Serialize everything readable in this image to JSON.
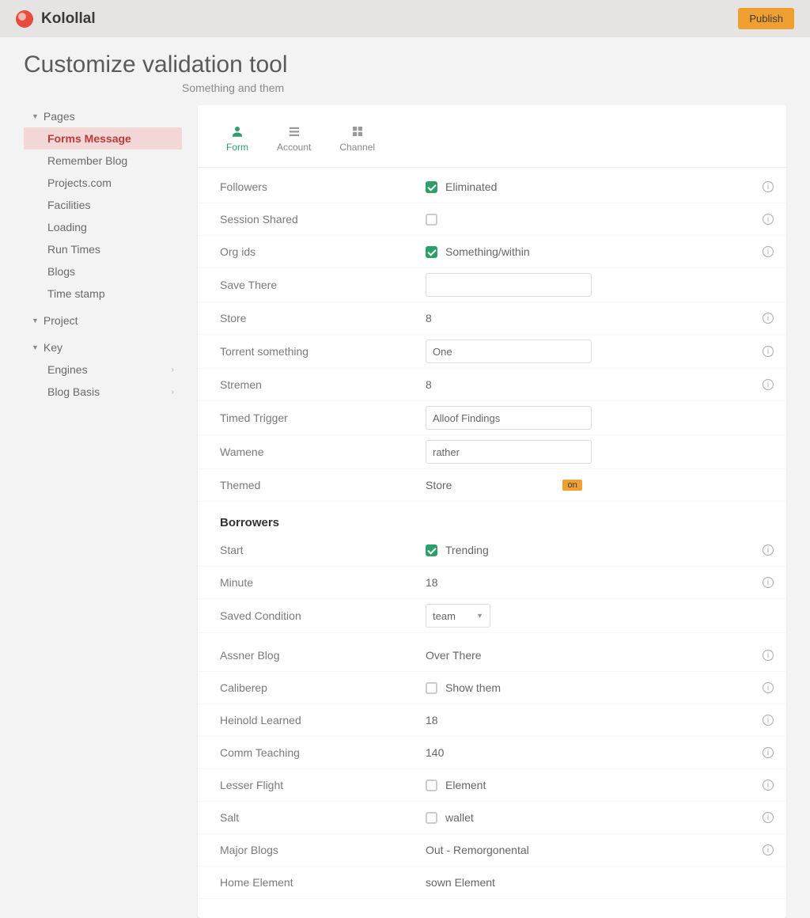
{
  "brand": "Kolollal",
  "publish": "Publish",
  "header": {
    "title": "Customize validation tool",
    "crumb": "Something and them"
  },
  "sidebar": {
    "group1": {
      "label": "Pages",
      "open": true,
      "items": [
        {
          "label": "Forms Message",
          "active": true
        },
        {
          "label": "Remember Blog"
        },
        {
          "label": "Projects.com"
        },
        {
          "label": "Facilities"
        },
        {
          "label": "Loading"
        },
        {
          "label": "Run Times"
        },
        {
          "label": "Blogs"
        },
        {
          "label": "Time stamp"
        }
      ]
    },
    "group2": {
      "label": "Project",
      "open": true
    },
    "group3": {
      "label": "Key",
      "open": true,
      "items": [
        {
          "label": "Engines",
          "chev": true
        },
        {
          "label": "Blog Basis",
          "chev": true
        }
      ]
    }
  },
  "tabs": [
    {
      "label": "Form",
      "icon": "user"
    },
    {
      "label": "Account",
      "icon": "list"
    },
    {
      "label": "Channel",
      "icon": "grid"
    }
  ],
  "rows1": [
    {
      "label": "Followers",
      "type": "check",
      "checked": true,
      "text": "Eliminated",
      "info": true
    },
    {
      "label": "Session Shared",
      "type": "check",
      "checked": false,
      "text": "",
      "info": true
    },
    {
      "label": "Org ids",
      "type": "check",
      "checked": true,
      "text": "Something/within",
      "info": true
    },
    {
      "label": "Save There",
      "type": "textbox",
      "value": ""
    },
    {
      "label": "Store",
      "type": "val",
      "value": "8",
      "info": true
    },
    {
      "label": "Torrent something",
      "type": "textbox",
      "value": "One",
      "info": true
    },
    {
      "label": "Stremen",
      "type": "val",
      "value": "8",
      "info": true
    },
    {
      "label": "Timed Trigger",
      "type": "textbox",
      "value": "Alloof Findings"
    },
    {
      "label": "Wamene",
      "type": "textbox",
      "value": "rather"
    },
    {
      "label": "Themed",
      "type": "badge",
      "value": "Store",
      "badge": "on"
    }
  ],
  "section2": "Borrowers",
  "rows2": [
    {
      "label": "Start",
      "type": "check",
      "checked": true,
      "text": "Trending",
      "info": true
    },
    {
      "label": "Minute",
      "type": "val",
      "value": "18",
      "info": true
    },
    {
      "label": "Saved Condition",
      "type": "select",
      "value": "team"
    }
  ],
  "rows3": [
    {
      "label": "Assner Blog",
      "type": "val",
      "value": "Over There",
      "info": true
    },
    {
      "label": "Caliberep",
      "type": "check",
      "checked": false,
      "text": "Show them",
      "info": true
    },
    {
      "label": "Heinold Learned",
      "type": "val",
      "value": "18",
      "info": true
    },
    {
      "label": "Comm Teaching",
      "type": "val",
      "value": "140",
      "info": true
    },
    {
      "label": "Lesser Flight",
      "type": "check",
      "checked": false,
      "text": "Element",
      "info": true
    },
    {
      "label": "Salt",
      "type": "check",
      "checked": false,
      "text": "wallet",
      "info": true
    },
    {
      "label": "Major Blogs",
      "type": "val",
      "value": "Out - Remorgonental",
      "info": true
    },
    {
      "label": "Home Element",
      "type": "val",
      "value": "sown Element"
    }
  ]
}
